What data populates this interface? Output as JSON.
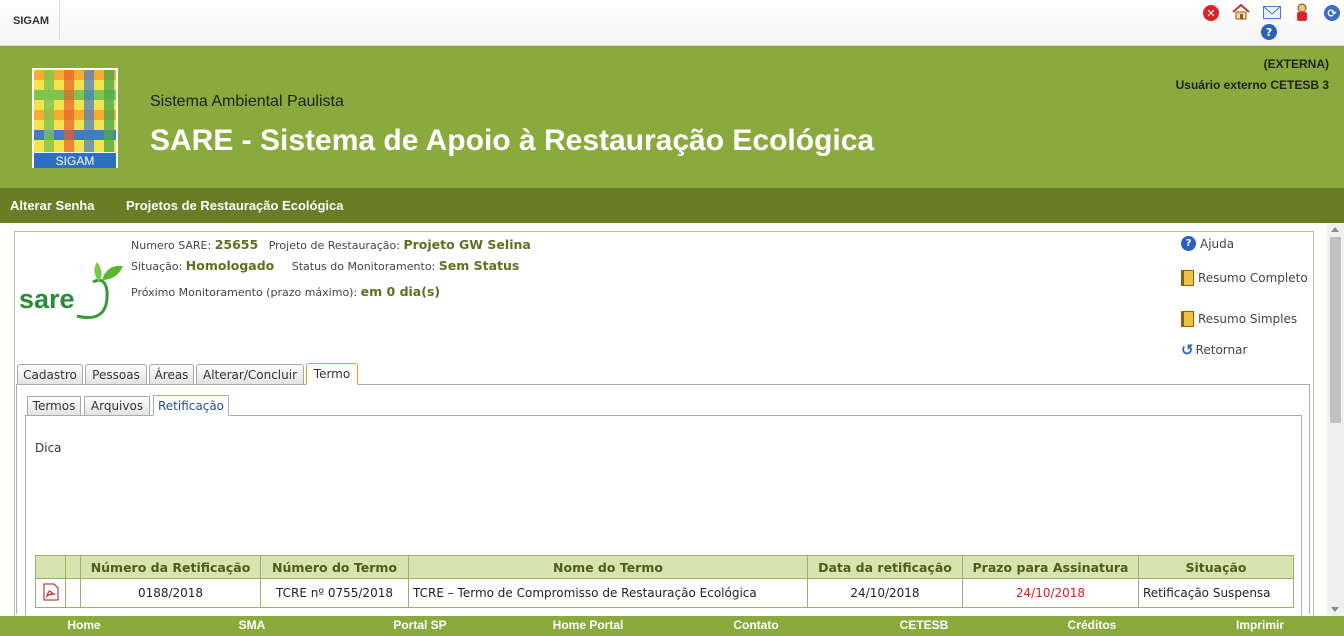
{
  "topbar": {
    "app_name": "SIGAM"
  },
  "icons": [
    "close-icon",
    "home-icon",
    "mail-icon",
    "user-icon",
    "logout-icon",
    "help-icon"
  ],
  "header": {
    "subtitle": "Sistema Ambiental Paulista",
    "title": "SARE - Sistema de Apoio à Restauração Ecológica",
    "logo_text": "SIGAM",
    "user_type": "(EXTERNA)",
    "user_name": "Usuário externo CETESB 3"
  },
  "nav": {
    "items": [
      "Alterar Senha",
      "Projetos de Restauração Ecológica"
    ]
  },
  "project": {
    "logo_text": "sare",
    "numero_label": "Numero SARE:",
    "numero_value": "25655",
    "projeto_label": "Projeto de Restauração:",
    "projeto_value": "Projeto GW Selina",
    "situacao_label": "Situação:",
    "situacao_value": "Homologado",
    "status_label": "Status do Monitoramento:",
    "status_value": "Sem Status",
    "proximo_label": "Próximo Monitoramento (prazo máximo):",
    "proximo_value": "em 0 dia(s)"
  },
  "side_links": {
    "ajuda": "Ajuda",
    "resumo_completo": "Resumo Completo",
    "resumo_simples": "Resumo Simples",
    "retornar": "Retornar"
  },
  "tabs": [
    "Cadastro",
    "Pessoas",
    "Áreas",
    "Alterar/Concluir",
    "Termo"
  ],
  "active_tab": "Termo",
  "subtabs": [
    "Termos",
    "Arquivos",
    "Retificação"
  ],
  "active_subtab": "Retificação",
  "dica": "Dica",
  "table": {
    "headers": [
      "",
      "",
      "Número da Retificação",
      "Número do Termo",
      "Nome do Termo",
      "Data da retificação",
      "Prazo para Assinatura",
      "Situação"
    ],
    "rows": [
      {
        "numero_retificacao": "0188/2018",
        "numero_termo": "TCRE nº 0755/2018",
        "nome_termo": "TCRE – Termo de Compromisso de Restauração Ecológica",
        "data_retificacao": "24/10/2018",
        "prazo_assinatura": "24/10/2018",
        "situacao": "Retificação Suspensa"
      }
    ]
  },
  "colors": {
    "header_green": "#8aaa3d",
    "nav_green": "#677e24",
    "deadline_red": "#cc2222",
    "accent_text": "#5a7220"
  },
  "footer": {
    "links": [
      "Home",
      "SMA",
      "Portal SP",
      "Home Portal",
      "Contato",
      "CETESB",
      "Créditos",
      "Imprimir"
    ]
  }
}
